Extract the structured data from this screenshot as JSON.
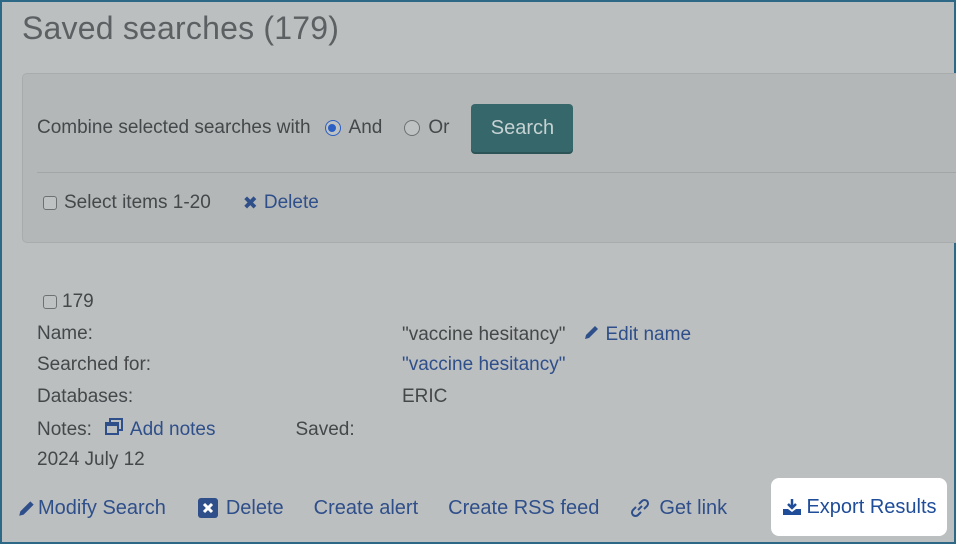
{
  "page": {
    "title": "Saved searches (179)"
  },
  "combine": {
    "label": "Combine selected searches with",
    "options": [
      {
        "label": "And",
        "checked": true
      },
      {
        "label": "Or",
        "checked": false
      }
    ],
    "search_button": "Search"
  },
  "bulk": {
    "select_label": "Select items 1-20",
    "delete_label": "Delete"
  },
  "record": {
    "number": "179",
    "name_label": "Name:",
    "name_value": "\"vaccine hesitancy\"",
    "edit_name": "Edit name",
    "searched_label": "Searched for:",
    "searched_value": "\"vaccine hesitancy\"",
    "databases_label": "Databases:",
    "databases_value": "ERIC",
    "notes_label": "Notes:",
    "add_notes": "Add notes",
    "saved_label": "Saved:",
    "saved_date": "2024 July 12"
  },
  "actions": {
    "modify": "Modify Search",
    "delete": "Delete",
    "alert": "Create alert",
    "rss": "Create RSS feed",
    "link": "Get link",
    "export": "Export Results"
  },
  "colors": {
    "accent": "#36676a",
    "link": "#2f4f8a",
    "frame": "#2d6886"
  }
}
